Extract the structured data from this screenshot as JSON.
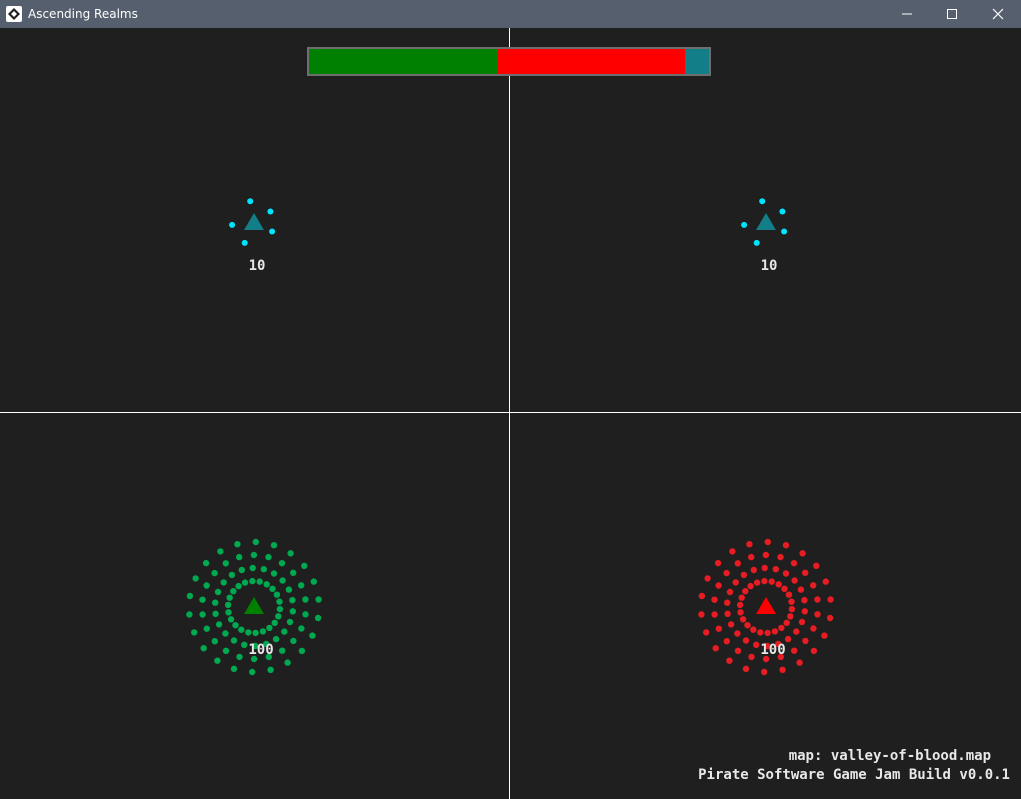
{
  "window": {
    "title": "Ascending Realms",
    "icon": "game-logo-icon",
    "controls": [
      "minimize-icon",
      "maximize-icon",
      "close-icon"
    ]
  },
  "hud": {
    "balance_bar": {
      "segments": [
        {
          "team": "green",
          "fraction": 0.47,
          "color": "#008000"
        },
        {
          "team": "red",
          "fraction": 0.47,
          "color": "#ff0000"
        },
        {
          "team": "teal",
          "fraction": 0.06,
          "color": "#127e87"
        }
      ]
    },
    "map_label": "map: valley-of-blood.map",
    "build_label": "Pirate Software Game Jam Build v0.0.1"
  },
  "quadrants": [
    {
      "id": "top-left",
      "base_color": "#127e87",
      "unit_color": "#00e5ff",
      "label": "10"
    },
    {
      "id": "top-right",
      "base_color": "#127e87",
      "unit_color": "#00e5ff",
      "label": "10"
    },
    {
      "id": "bottom-left",
      "base_color": "#008000",
      "unit_color": "#00a84f",
      "label": "100"
    },
    {
      "id": "bottom-right",
      "base_color": "#ff0000",
      "unit_color": "#e81c23",
      "label": "100"
    }
  ]
}
